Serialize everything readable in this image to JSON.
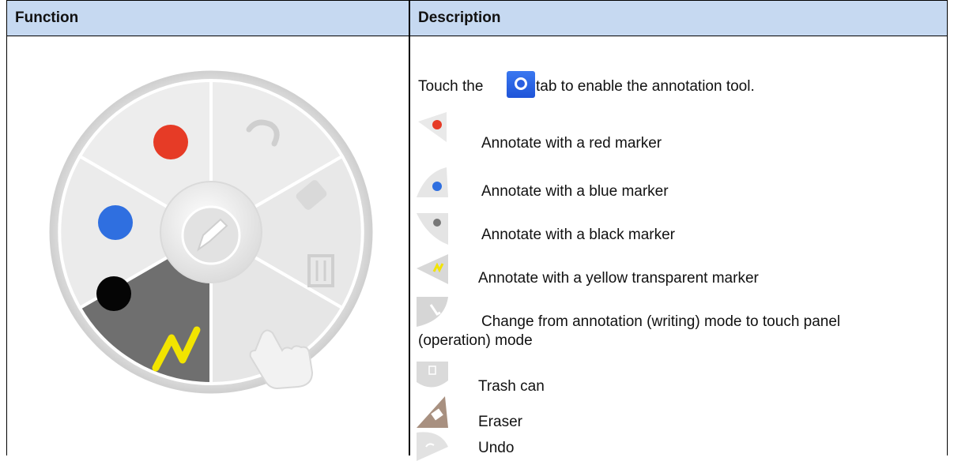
{
  "table": {
    "header": {
      "function": "Function",
      "description": "Description"
    }
  },
  "description": {
    "intro_before": "Touch the",
    "intro_after": "tab to enable the annotation tool.",
    "items": [
      {
        "label": "Annotate with a red marker",
        "icon": "red-marker-icon",
        "color": "#e63b26"
      },
      {
        "label": "Annotate with a blue marker",
        "icon": "blue-marker-icon",
        "color": "#2f6fe0"
      },
      {
        "label": "Annotate with a black marker",
        "icon": "black-marker-icon",
        "color": "#777777"
      },
      {
        "label": "Annotate with a yellow transparent marker",
        "icon": "yellow-marker-icon",
        "color": "#f2e400"
      },
      {
        "label": "Change from annotation (writing) mode to touch panel (operation) mode",
        "icon": "touch-mode-icon"
      },
      {
        "label": "Trash can",
        "icon": "trash-icon"
      },
      {
        "label": "Eraser",
        "icon": "eraser-icon"
      },
      {
        "label": "Undo",
        "icon": "undo-icon"
      }
    ]
  },
  "colors": {
    "header_bg": "#c6d9f1",
    "red": "#e63b26",
    "blue": "#2f6fe0",
    "black": "#050505",
    "yellow": "#f2e400",
    "selected_segment": "#6f6f6f"
  }
}
